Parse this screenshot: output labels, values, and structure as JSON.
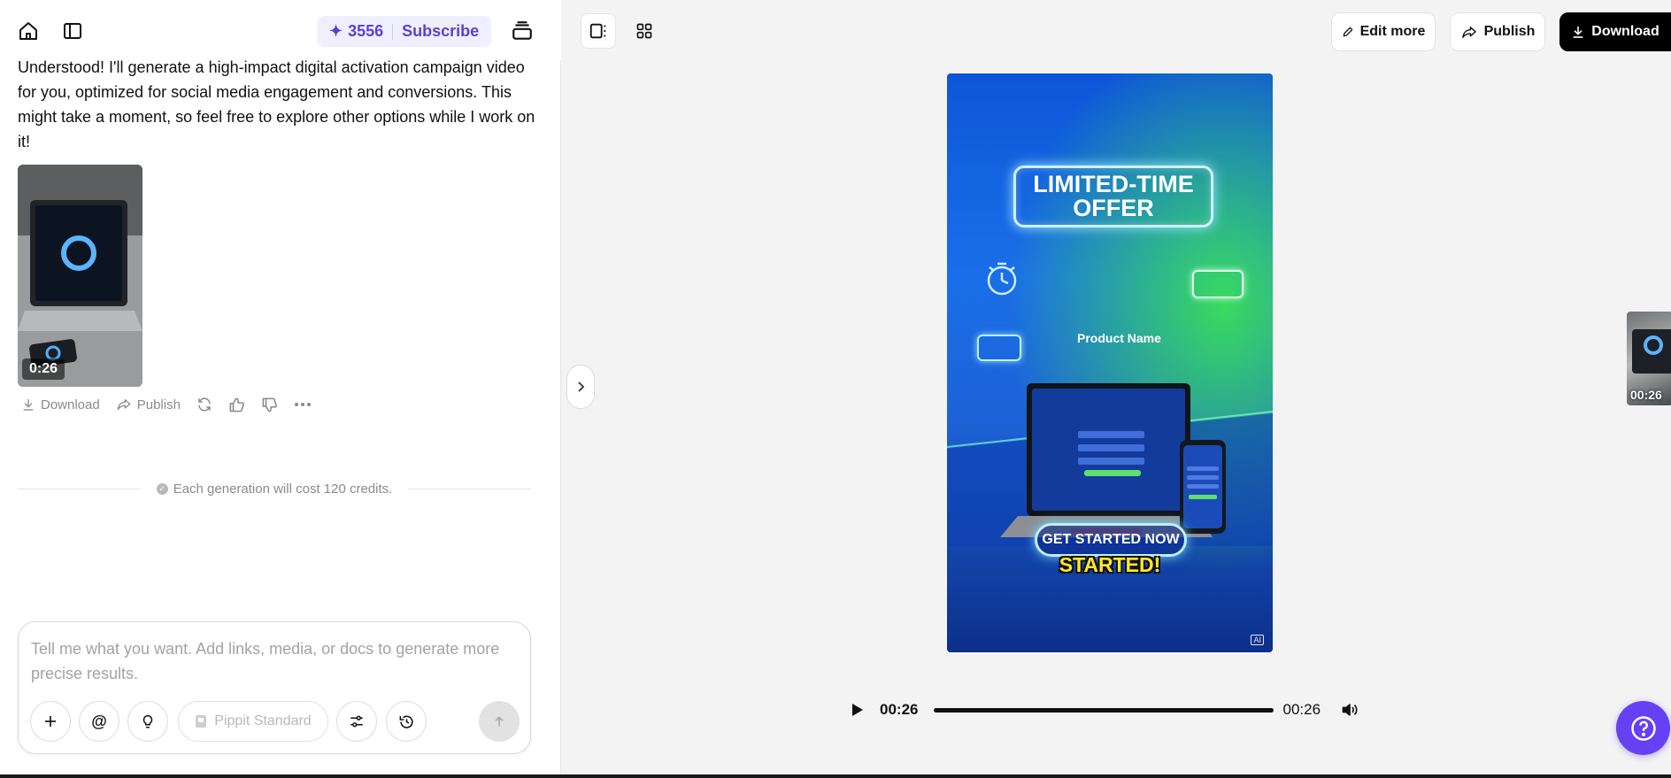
{
  "header": {
    "credits": "3556",
    "subscribe_label": "Subscribe",
    "accent_color": "#5b3fd6"
  },
  "chat": {
    "message": "Understood! I'll generate a high-impact digital activation campaign video for you, optimized for social media engagement and conversions. This might take a moment, so feel free to explore other options while I work on it!",
    "video_duration": "0:26",
    "actions": {
      "download_label": "Download",
      "publish_label": "Publish"
    },
    "cost_note": "Each generation will cost 120 credits."
  },
  "composer": {
    "placeholder": "Tell me what you want. Add links, media, or docs to generate more precise results.",
    "model_label": "Pippit Standard"
  },
  "toolbar": {
    "edit_more_label": "Edit more",
    "publish_label": "Publish",
    "download_label": "Download"
  },
  "preview": {
    "offer_line1": "LIMITED-TIME",
    "offer_line2": "OFFER",
    "screen_title": "Product Name",
    "cta_label": "GET STARTED NOW",
    "started_label": "STARTED!",
    "ai_tag": "AI"
  },
  "player": {
    "current_time": "00:26",
    "total_time": "00:26",
    "progress": 1.0
  },
  "side_thumb": {
    "duration": "00:26"
  }
}
